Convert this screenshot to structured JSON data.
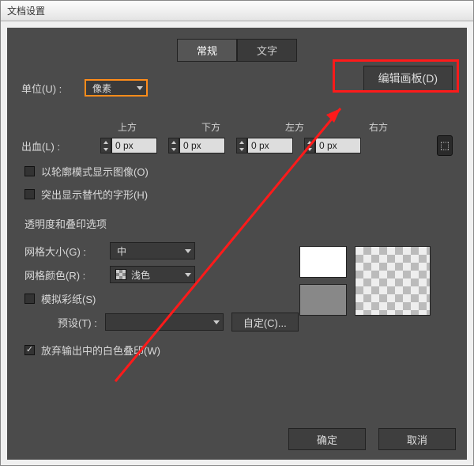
{
  "window": {
    "title": "文档设置"
  },
  "tabs": {
    "general": "常规",
    "text": "文字"
  },
  "units": {
    "label": "单位(U) :",
    "value": "像素"
  },
  "editArtboard": "编辑画板(D)",
  "bleed": {
    "label": "出血(L) :",
    "cols": {
      "top": "上方",
      "bottom": "下方",
      "left": "左方",
      "right": "右方"
    },
    "vals": {
      "top": "0 px",
      "bottom": "0 px",
      "left": "0 px",
      "right": "0 px"
    }
  },
  "chk": {
    "outline": "以轮廓模式显示图像(O)",
    "altGlyph": "突出显示替代的字形(H)",
    "simPaper": "模拟彩纸(S)",
    "discardWhite": "放弃输出中的白色叠印(W)"
  },
  "sectTrans": "透明度和叠印选项",
  "grid": {
    "sizeLabel": "网格大小(G) :",
    "sizeValue": "中",
    "colorLabel": "网格颜色(R) :",
    "colorValue": "浅色"
  },
  "preset": {
    "label": "预设(T) :",
    "btn": "自定(C)..."
  },
  "btns": {
    "ok": "确定",
    "cancel": "取消"
  }
}
